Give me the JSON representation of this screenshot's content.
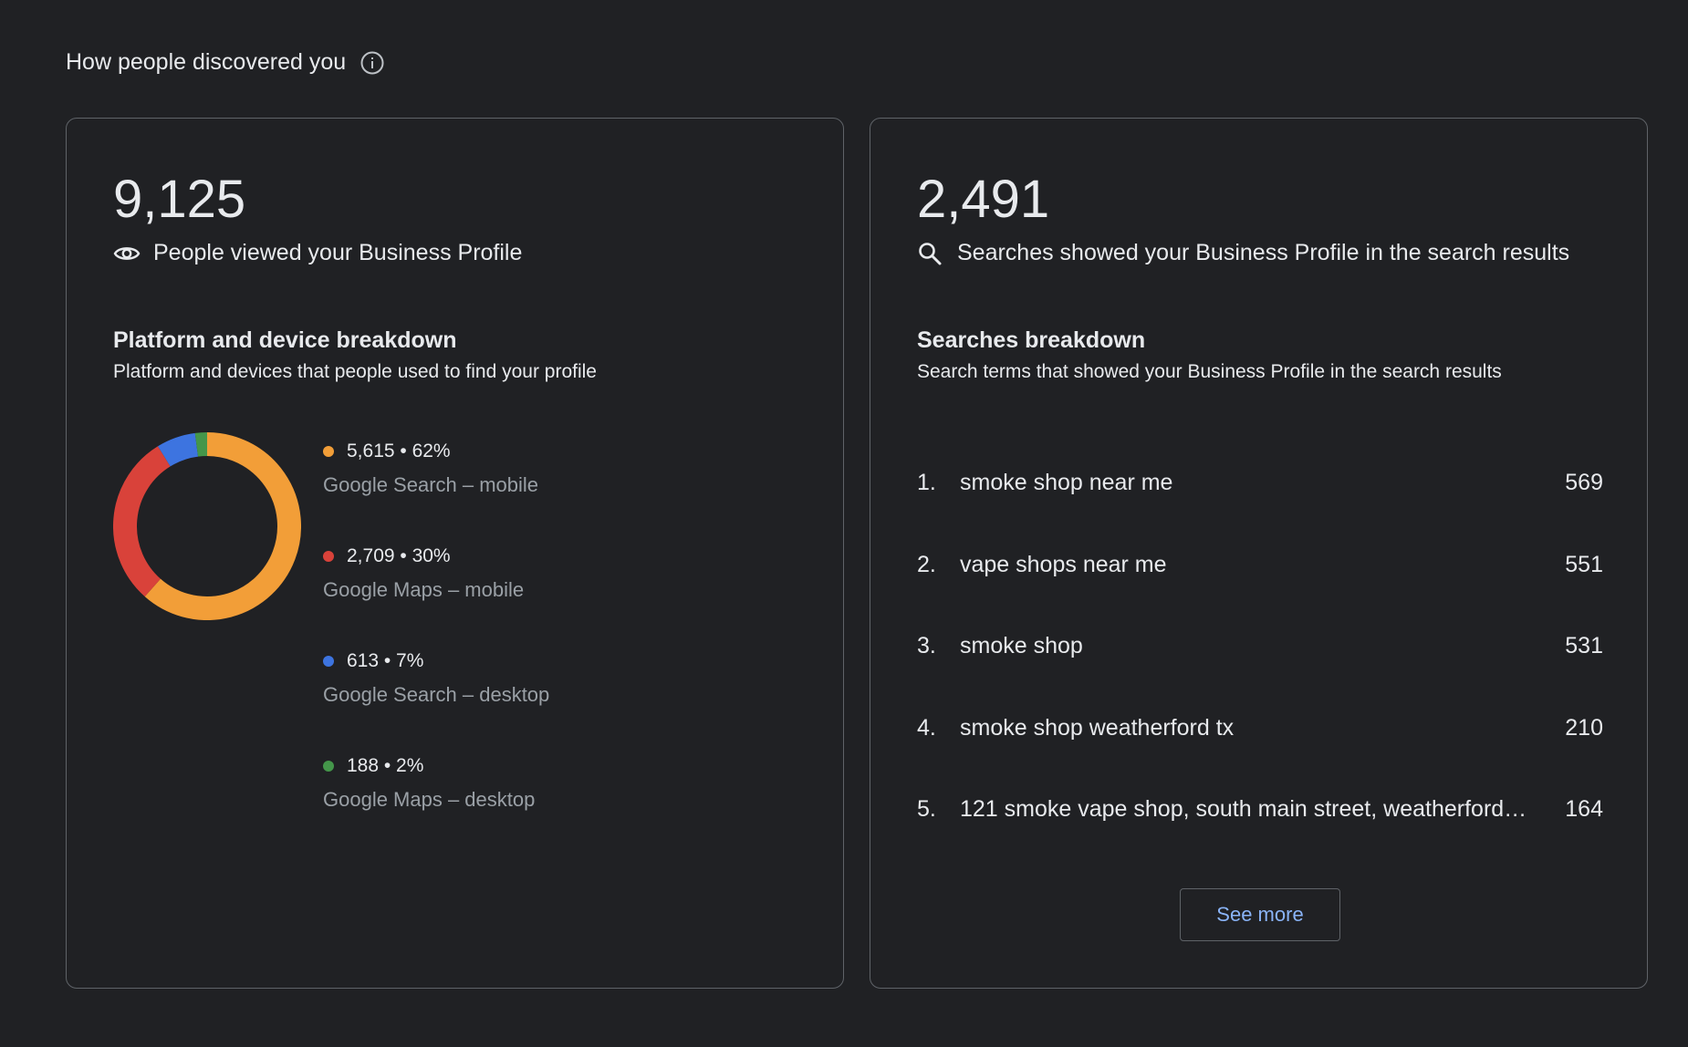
{
  "header": {
    "title": "How people discovered you",
    "info_icon": "info-icon"
  },
  "views_card": {
    "total": "9,125",
    "icon": "eye-icon",
    "caption": "People viewed your Business Profile",
    "breakdown_title": "Platform and device breakdown",
    "breakdown_desc": "Platform and devices that people used to find your profile",
    "chart_data": {
      "type": "pie",
      "donut": true,
      "categories": [
        "Google Search – mobile",
        "Google Maps – mobile",
        "Google Search – desktop",
        "Google Maps – desktop"
      ],
      "values": [
        5615,
        2709,
        613,
        188
      ],
      "percents": [
        62,
        30,
        7,
        2
      ],
      "colors": [
        "#f29e38",
        "#d9423a",
        "#3d74e0",
        "#44964a"
      ]
    },
    "legend": [
      {
        "value": "5,615 • 62%",
        "label": "Google Search – mobile",
        "color": "#f29e38"
      },
      {
        "value": "2,709 • 30%",
        "label": "Google Maps – mobile",
        "color": "#d9423a"
      },
      {
        "value": "613 • 7%",
        "label": "Google Search – desktop",
        "color": "#3d74e0"
      },
      {
        "value": "188 • 2%",
        "label": "Google Maps – desktop",
        "color": "#44964a"
      }
    ]
  },
  "searches_card": {
    "total": "2,491",
    "icon": "search-icon",
    "caption": "Searches showed your Business Profile in the search results",
    "breakdown_title": "Searches breakdown",
    "breakdown_desc": "Search terms that showed your Business Profile in the search results",
    "terms": [
      {
        "rank": "1.",
        "term": "smoke shop near me",
        "count": "569"
      },
      {
        "rank": "2.",
        "term": "vape shops near me",
        "count": "551"
      },
      {
        "rank": "3.",
        "term": "smoke shop",
        "count": "531"
      },
      {
        "rank": "4.",
        "term": "smoke shop weatherford tx",
        "count": "210"
      },
      {
        "rank": "5.",
        "term": "121 smoke vape shop, south main street, weatherford…",
        "count": "164"
      }
    ],
    "see_more_label": "See more"
  }
}
